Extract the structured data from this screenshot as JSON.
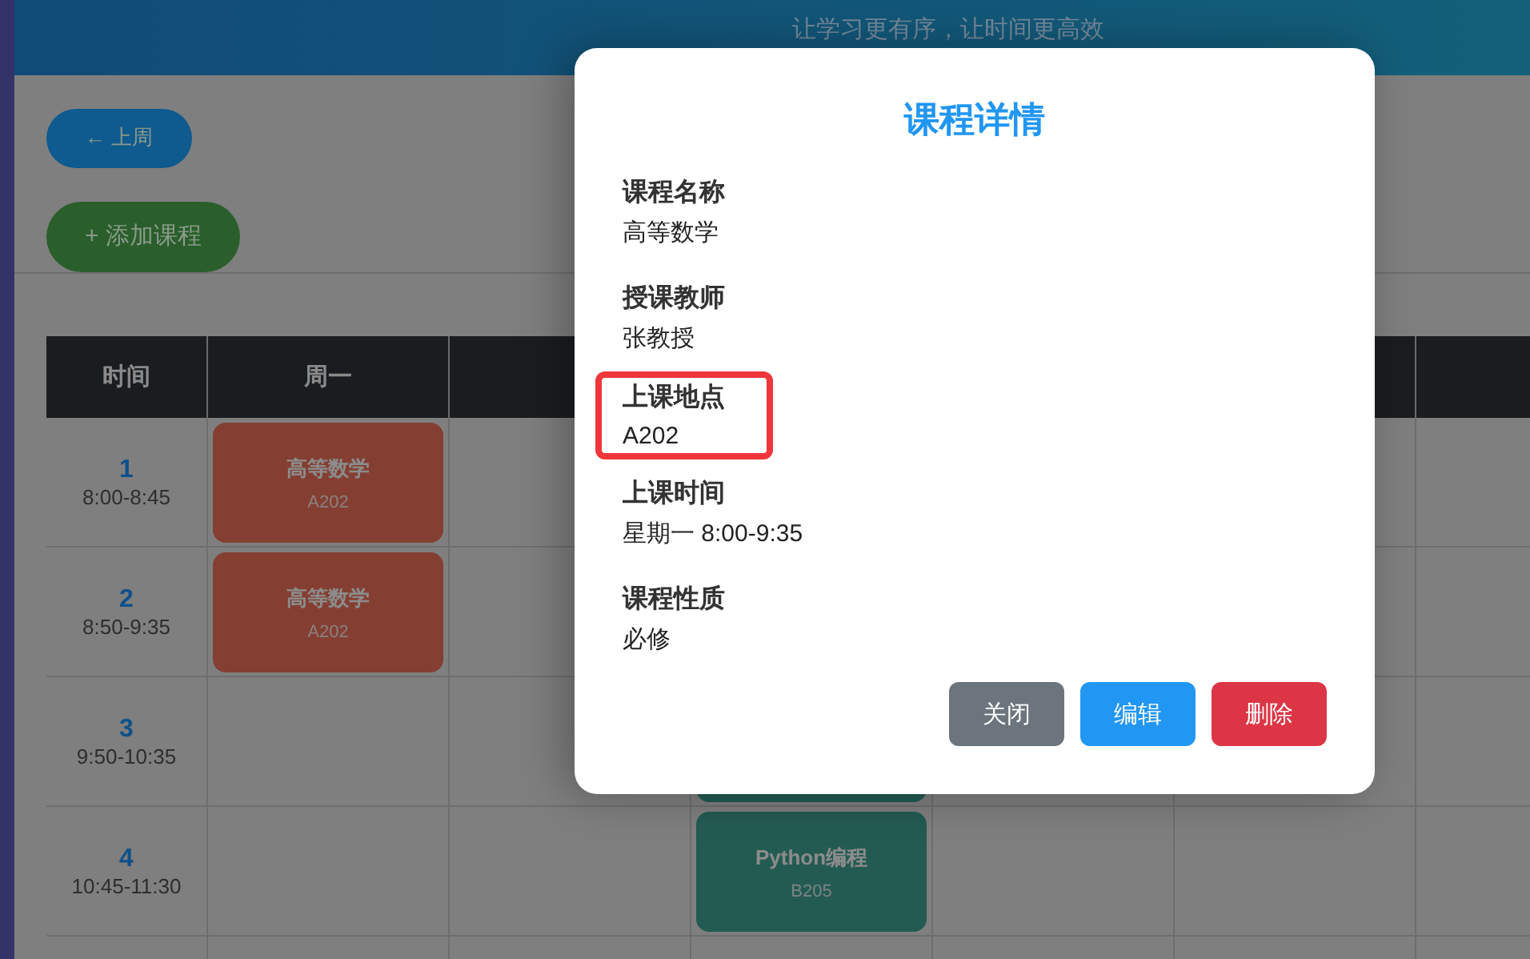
{
  "header": {
    "subtitle": "让学习更有序，让时间更高效"
  },
  "toolbar": {
    "prev_week": "← 上周",
    "add_course": "+ 添加课程"
  },
  "table": {
    "columns": [
      {
        "label": "时间"
      },
      {
        "label": "周一"
      },
      {},
      {},
      {},
      {},
      {}
    ],
    "rows": [
      {
        "period": "1",
        "time": "8:00-8:45",
        "cells": [
          {
            "name": "高等数学",
            "room": "A202",
            "color": "#843f32"
          },
          null,
          null,
          null,
          null,
          null
        ]
      },
      {
        "period": "2",
        "time": "8:50-9:35",
        "cells": [
          {
            "name": "高等数学",
            "room": "A202",
            "color": "#843f32"
          },
          null,
          null,
          null,
          null,
          null
        ]
      },
      {
        "period": "3",
        "time": "9:50-10:35",
        "cells": [
          null,
          null,
          {
            "color": "#235b52"
          },
          null,
          null,
          null
        ]
      },
      {
        "period": "4",
        "time": "10:45-11:30",
        "cells": [
          null,
          null,
          {
            "name": "Python编程",
            "room": "B205",
            "color": "#235b52"
          },
          null,
          null,
          null
        ]
      },
      {
        "cells": [
          null,
          null,
          null,
          null,
          null,
          null
        ]
      }
    ]
  },
  "modal": {
    "title": "课程详情",
    "fields": [
      {
        "label": "课程名称",
        "value": "高等数学",
        "highlighted": false
      },
      {
        "label": "授课教师",
        "value": "张教授",
        "highlighted": false
      },
      {
        "label": "上课地点",
        "value": "A202",
        "highlighted": true
      },
      {
        "label": "上课时间",
        "value": "星期一 8:00-9:35",
        "highlighted": false
      },
      {
        "label": "课程性质",
        "value": "必修",
        "highlighted": false
      }
    ],
    "buttons": [
      {
        "label": "关闭",
        "kind": "secondary"
      },
      {
        "label": "编辑",
        "kind": "primary"
      },
      {
        "label": "删除",
        "kind": "danger"
      }
    ]
  }
}
